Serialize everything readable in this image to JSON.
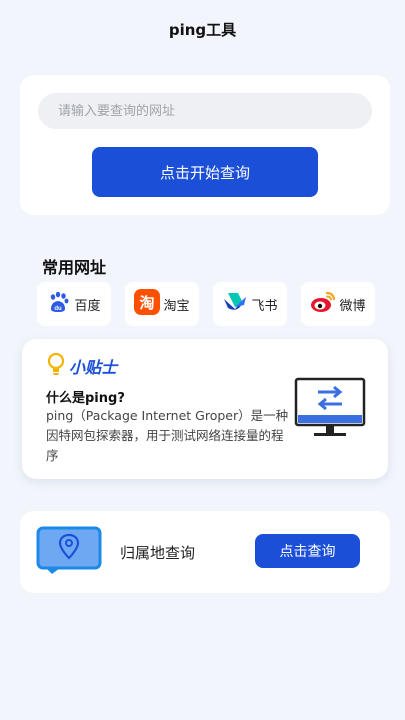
{
  "header": {
    "title": "ping工具"
  },
  "search": {
    "placeholder": "请输入要查询的网址",
    "button_label": "点击开始查询"
  },
  "common_sites": {
    "title": "常用网址",
    "items": [
      {
        "label": "百度",
        "icon": "baidu-logo-icon"
      },
      {
        "label": "淘宝",
        "icon": "taobao-logo-icon"
      },
      {
        "label": "飞书",
        "icon": "feishu-logo-icon"
      },
      {
        "label": "微博",
        "icon": "weibo-logo-icon"
      }
    ]
  },
  "tip": {
    "brand": "小贴士",
    "question": "什么是ping?",
    "body": "ping（Package Internet Groper）是一种因特网包探索器，用于测试网络连接量的程序",
    "icons": [
      "lightbulb-icon",
      "monitor-transfer-icon"
    ]
  },
  "locate": {
    "label": "归属地查询",
    "button_label": "点击查询",
    "icon": "map-location-icon"
  },
  "colors": {
    "accent": "#1c4fd8",
    "background": "#f2f6fc"
  }
}
